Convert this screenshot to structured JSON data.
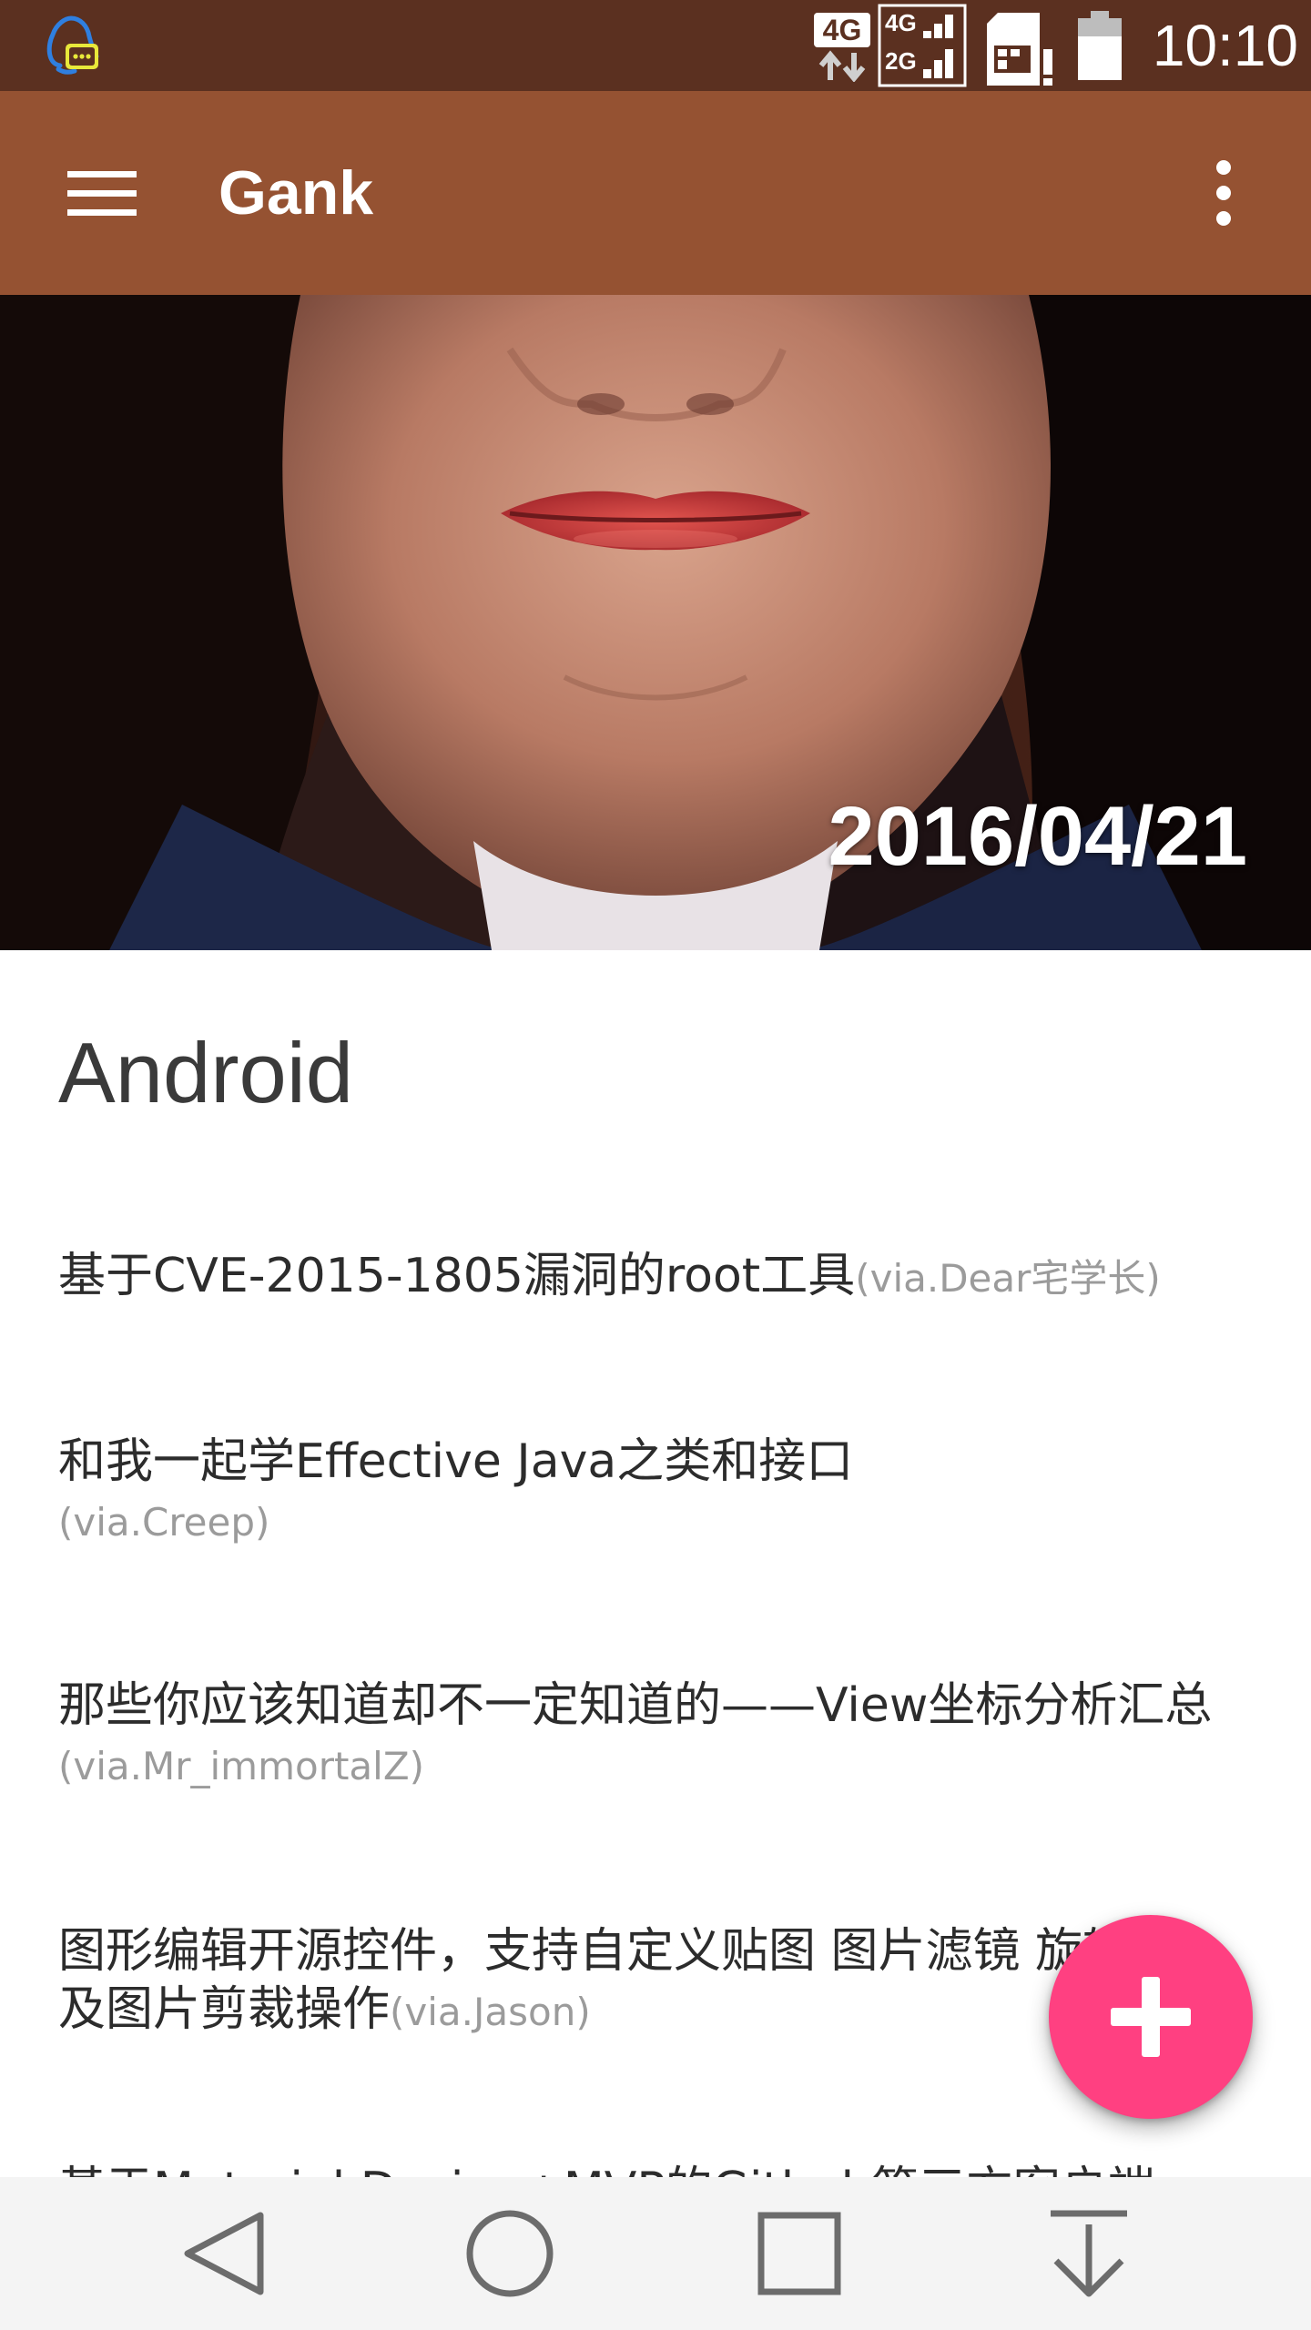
{
  "status_bar": {
    "time": "10:10",
    "network_label": "4G",
    "signal_label_top": "4G",
    "signal_label_bottom": "2G",
    "icons": [
      "qq-notification-icon",
      "network-4g-icon",
      "signal-icon",
      "sim-icon",
      "battery-icon"
    ]
  },
  "app_bar": {
    "title": "Gank",
    "icons": [
      "menu-icon",
      "more-vert-icon"
    ]
  },
  "hero": {
    "date": "2016/04/21"
  },
  "section": {
    "title": "Android",
    "items": [
      {
        "text": "基于CVE-2015-1805漏洞的root工具",
        "via": "(via.Dear宅学长)"
      },
      {
        "text": "和我一起学Effective Java之类和接口",
        "via": "(via.Creep)"
      },
      {
        "text": "那些你应该知道却不一定知道的——View坐标分析汇总",
        "via": "(via.Mr_immortalZ)"
      },
      {
        "text": "图形编辑开源控件，支持自定义贴图 图片滤镜 旋转 以及图片剪裁操作",
        "via": "(via.Jason)"
      },
      {
        "text": "基于Material Design+MVP的Github第三方客户端",
        "via": ""
      }
    ]
  },
  "fab": {
    "icon": "add-icon",
    "color": "#ff4081"
  },
  "nav_bar": {
    "icons": [
      "back-icon",
      "home-icon",
      "recents-icon",
      "down-icon"
    ]
  },
  "colors": {
    "status_bar": "#5b3020",
    "app_bar": "#955232",
    "accent": "#ff4081",
    "via_text": "#9b9b9b"
  }
}
